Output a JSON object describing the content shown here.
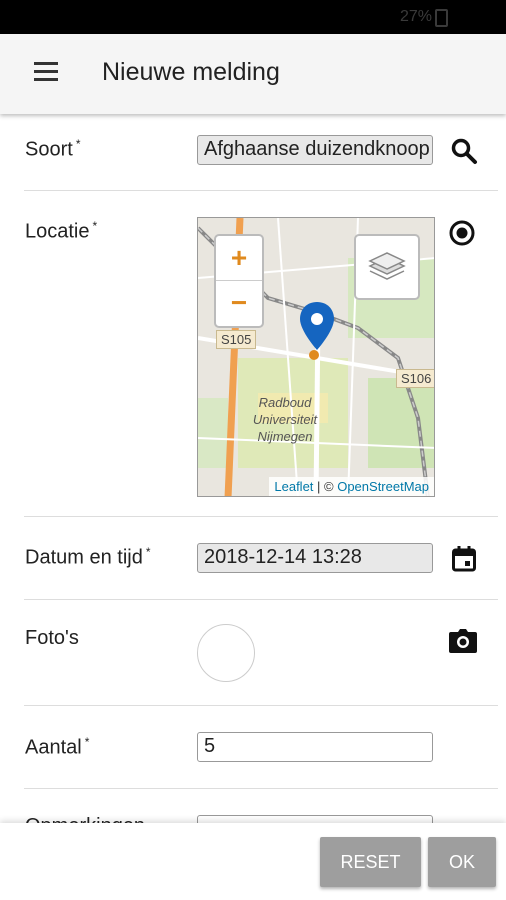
{
  "status": {
    "battery": "27%"
  },
  "header": {
    "title": "Nieuwe melding"
  },
  "form": {
    "soort": {
      "label": "Soort",
      "required": "*",
      "value": "Afghaanse duizendknoop"
    },
    "locatie": {
      "label": "Locatie",
      "required": "*"
    },
    "datum": {
      "label": "Datum en tijd",
      "required": "*",
      "value": "2018-12-14 13:28"
    },
    "fotos": {
      "label": "Foto's"
    },
    "aantal": {
      "label": "Aantal",
      "required": "*",
      "value": "5"
    },
    "opmerkingen": {
      "label": "Opmerkingen"
    }
  },
  "map": {
    "zoom_in": "+",
    "zoom_out": "−",
    "road_labels": [
      "S105",
      "S106"
    ],
    "place_label": [
      "Radboud",
      "Universiteit",
      "Nijmegen"
    ],
    "attribution": {
      "leaflet": "Leaflet",
      "sep": " | © ",
      "osm": "OpenStreetMap"
    }
  },
  "actions": {
    "reset": "RESET",
    "ok": "OK"
  },
  "colors": {
    "accent": "#e08a1e",
    "marker": "#1565c0",
    "button": "#9e9e9e"
  }
}
